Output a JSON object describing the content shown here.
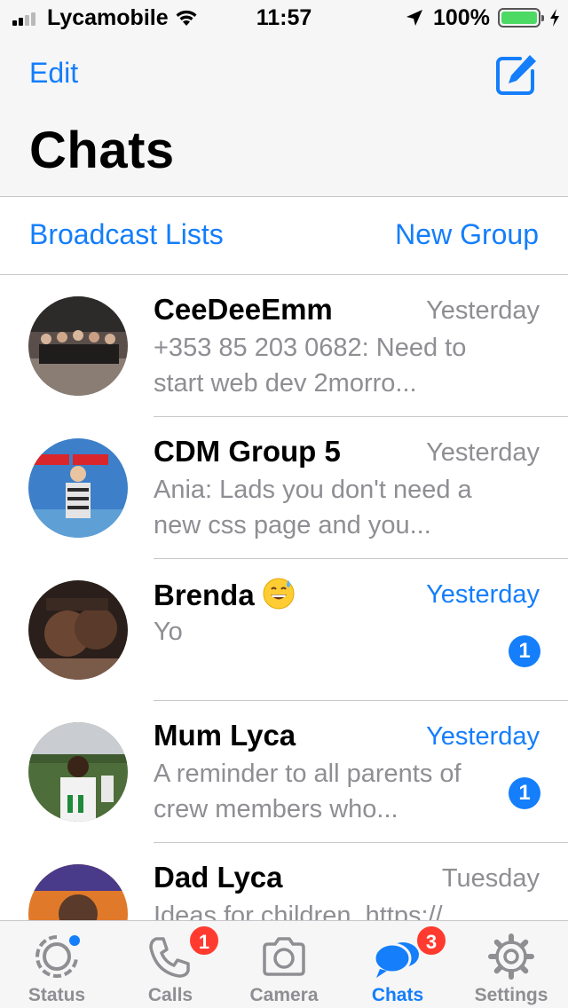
{
  "status_bar": {
    "carrier": "Lycamobile",
    "time": "11:57",
    "battery_percent": "100%",
    "signal_bars": 2,
    "battery_level": 1.0,
    "battery_color": "#4cd964"
  },
  "header": {
    "edit_label": "Edit",
    "title": "Chats",
    "compose_icon": "compose-icon"
  },
  "links": {
    "broadcast_label": "Broadcast Lists",
    "new_group_label": "New Group"
  },
  "chats": [
    {
      "name": "CeeDeeEmm",
      "time": "Yesterday",
      "preview": "+353 85 203 0682: Need to start web dev 2morro...",
      "unread": ""
    },
    {
      "name": "CDM Group 5",
      "time": "Yesterday",
      "preview": "Ania: Lads you don't need a new css page and you...",
      "unread": ""
    },
    {
      "name": "Brenda",
      "time": "Yesterday",
      "preview": "Yo",
      "unread": "1",
      "name_emoji": "grinning-sweat-emoji"
    },
    {
      "name": "Mum Lyca",
      "time": "Yesterday",
      "preview": "A reminder to all parents of crew members who...",
      "unread": "1"
    },
    {
      "name": "Dad Lyca",
      "time": "Tuesday",
      "preview": "Ideas for children. https://",
      "unread": ""
    }
  ],
  "tabs": [
    {
      "label": "Status",
      "icon": "status-icon",
      "badge": ""
    },
    {
      "label": "Calls",
      "icon": "phone-icon",
      "badge": "1"
    },
    {
      "label": "Camera",
      "icon": "camera-icon",
      "badge": ""
    },
    {
      "label": "Chats",
      "icon": "chats-icon",
      "badge": "3",
      "active": true
    },
    {
      "label": "Settings",
      "icon": "gear-icon",
      "badge": ""
    }
  ],
  "colors": {
    "accent": "#147efb",
    "badge": "#ff3b30",
    "secondary_text": "#8e8e93"
  }
}
